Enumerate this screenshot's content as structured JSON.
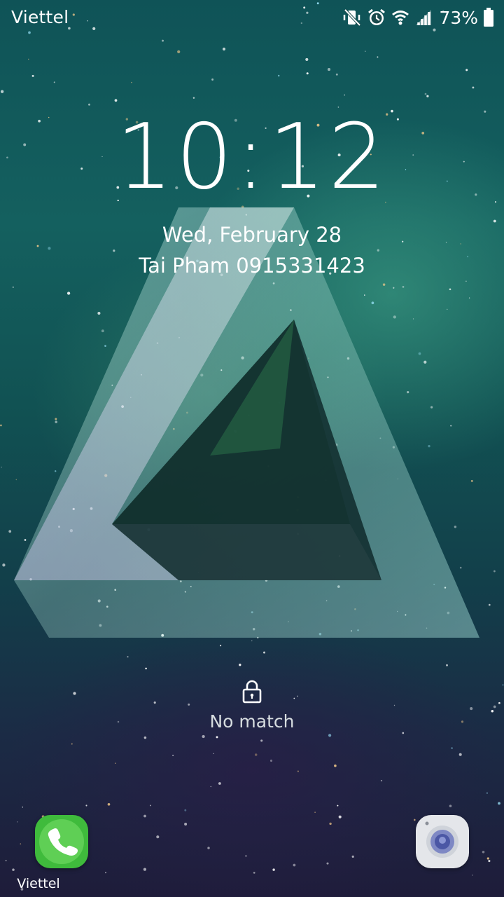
{
  "status_bar": {
    "carrier": "Viettel",
    "icons": [
      "vibrate-mute-icon",
      "alarm-icon",
      "wifi-icon",
      "signal-icon",
      "battery-icon"
    ],
    "battery_percent": "73%"
  },
  "lock_screen": {
    "time": "10:12",
    "date": "Wed, February 28",
    "owner_info": "Tai Pham 0915331423",
    "unlock_status": "No match"
  },
  "shortcuts": {
    "left": {
      "label": "Viettel",
      "icon": "phone-icon",
      "color": "#3fbb3c"
    },
    "right": {
      "icon": "camera-icon",
      "color": "#e4e6ea"
    }
  }
}
